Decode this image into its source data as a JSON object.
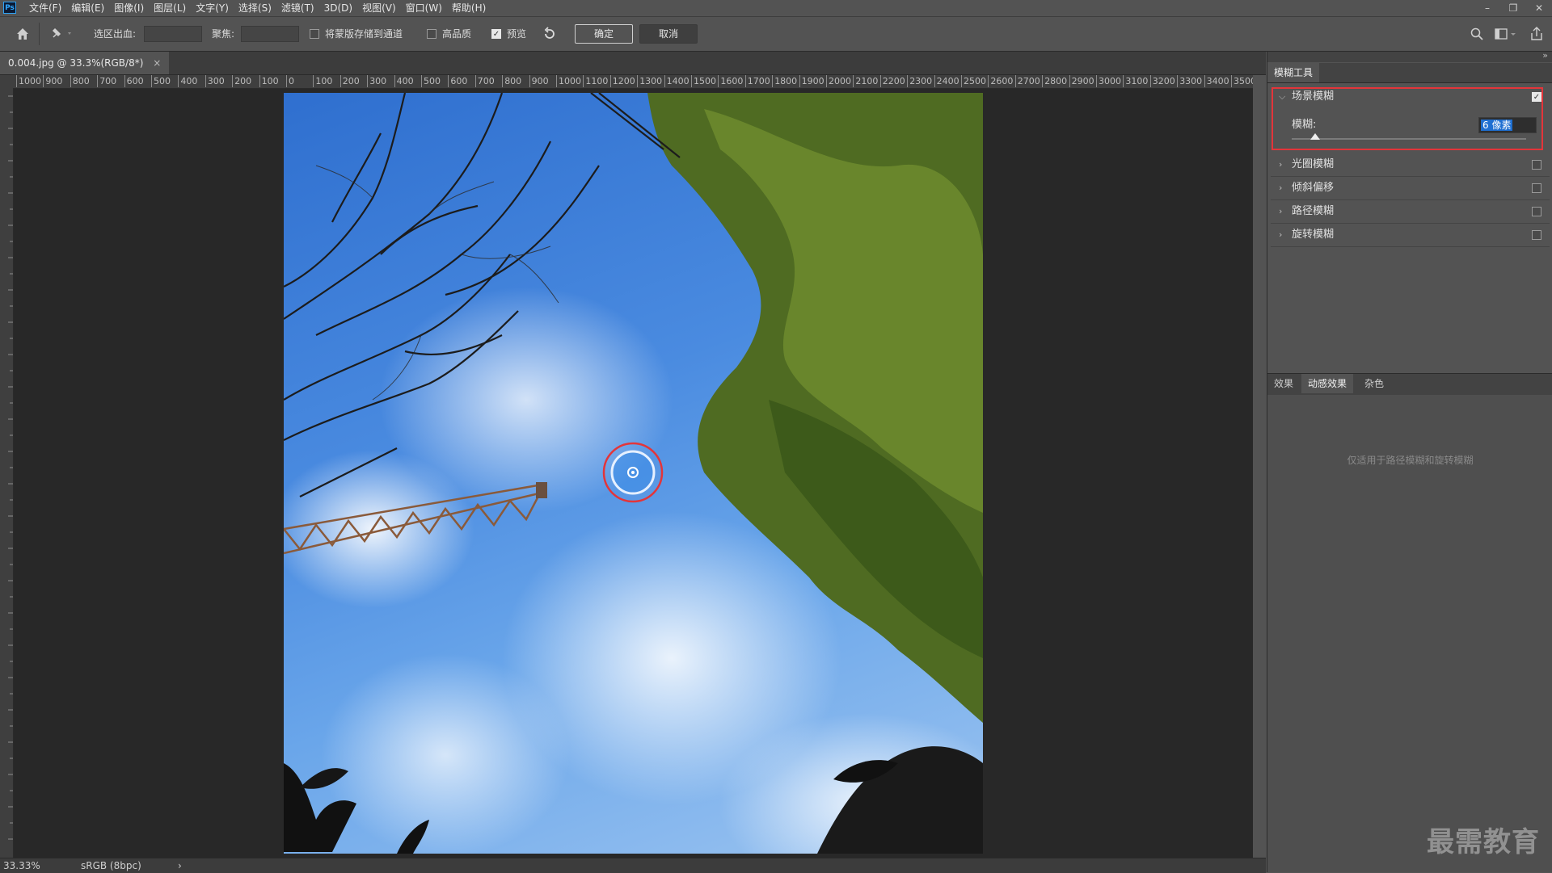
{
  "app": {
    "logo": "Ps"
  },
  "menu": [
    "文件(F)",
    "编辑(E)",
    "图像(I)",
    "图层(L)",
    "文字(Y)",
    "选择(S)",
    "滤镜(T)",
    "3D(D)",
    "视图(V)",
    "窗口(W)",
    "帮助(H)"
  ],
  "window_controls": {
    "minimize": "–",
    "restore": "❐",
    "close": "✕"
  },
  "options": {
    "selection_out_label": "选区出血:",
    "focus_label": "聚焦:",
    "save_mask_label": "将蒙版存储到通道",
    "high_quality_label": "高品质",
    "preview_label": "预览",
    "preview_checked": true,
    "save_mask_checked": false,
    "high_quality_checked": false,
    "ok_label": "确定",
    "cancel_label": "取消"
  },
  "document": {
    "tab_title": "0.004.jpg @ 33.3%(RGB/8*)",
    "close_glyph": "×"
  },
  "ruler": {
    "horizontal_labels": [
      "1000",
      "900",
      "800",
      "700",
      "600",
      "500",
      "400",
      "300",
      "200",
      "100",
      "0",
      "100",
      "200",
      "300",
      "400",
      "500",
      "600",
      "700",
      "800",
      "900",
      "1000",
      "1100",
      "1200",
      "1300",
      "1400",
      "1500",
      "1600",
      "1700",
      "1800",
      "1900",
      "2000",
      "2100",
      "2200",
      "2300",
      "2400",
      "2500",
      "2600",
      "2700",
      "2800",
      "2900",
      "3000",
      "3100",
      "3200",
      "3300",
      "3400",
      "3500"
    ]
  },
  "panel": {
    "title_tab": "模糊工具",
    "blurs": [
      {
        "label": "场景模糊",
        "expanded": true,
        "checked": true
      },
      {
        "label": "光圈模糊",
        "expanded": false,
        "checked": false
      },
      {
        "label": "倾斜偏移",
        "expanded": false,
        "checked": false
      },
      {
        "label": "路径模糊",
        "expanded": false,
        "checked": false
      },
      {
        "label": "旋转模糊",
        "expanded": false,
        "checked": false
      }
    ],
    "blur_amount_label": "模糊:",
    "blur_amount_value": "6 像素",
    "blur_amount_fraction": 0.1,
    "effect_tabs": [
      "效果",
      "动感效果",
      "杂色"
    ],
    "active_effect_tab": "动感效果",
    "effect_note": "仅适用于路径模糊和旋转模糊"
  },
  "status": {
    "zoom": "33.33%",
    "color_profile": "sRGB (8bpc)",
    "arrow": "›"
  },
  "watermark": "最需教育",
  "colors": {
    "highlight": "#e3353a",
    "accent": "#1f6fd1"
  }
}
